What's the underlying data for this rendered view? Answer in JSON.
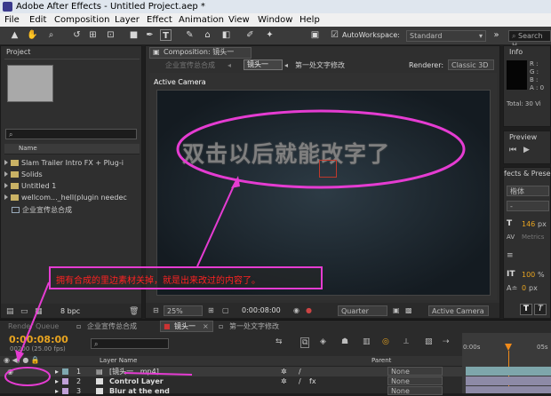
{
  "window": {
    "title": "Adobe After Effects - Untitled Project.aep *"
  },
  "menu": [
    "File",
    "Edit",
    "Composition",
    "Layer",
    "Effect",
    "Animation",
    "View",
    "Window",
    "Help"
  ],
  "toolbar": {
    "workspace_label": "AutoWorkspace:",
    "workspace_value": "Standard",
    "search_placeholder": "Search H"
  },
  "project": {
    "tab": "Project",
    "name_header": "Name",
    "items": [
      {
        "label": "Slam Trailer Intro FX + Plug-i",
        "type": "folder"
      },
      {
        "label": "Solids",
        "type": "folder"
      },
      {
        "label": "Untitled 1",
        "type": "folder"
      },
      {
        "label": "wellcom..._hell(plugin needec",
        "type": "folder"
      },
      {
        "label": "企业宣传总合成",
        "type": "comp"
      }
    ],
    "bpc": "8 bpc"
  },
  "composition": {
    "tab": "Composition: 镜头一",
    "breadcrumbs": [
      "企业宣传总合成",
      "镜头一",
      "第一处文字修改"
    ],
    "renderer_label": "Renderer:",
    "renderer_value": "Classic 3D",
    "active_camera": "Active Camera",
    "canvas_text": "双击以后就能改字了",
    "zoom": "25%",
    "timecode": "0:00:08:00",
    "resolution": "Quarter",
    "view": "Active Camera"
  },
  "annotation": {
    "text": "拥有合成的里边素材关掉，就是出来改过的内容了。"
  },
  "info": {
    "tab": "Info",
    "labels": [
      "R :",
      "G :",
      "B :",
      "A : 0"
    ],
    "total": "Total: 30  Vi"
  },
  "preview": {
    "tab": "Preview"
  },
  "effects": {
    "tab": "fects & Prese",
    "font_name": "楷体",
    "font_size": "146",
    "size_unit": "px",
    "metrics": "Metrics",
    "scale": "100",
    "scale_unit": "%",
    "baseline": "0",
    "baseline_unit": "px"
  },
  "timeline": {
    "tabs": [
      "Render Queue",
      "企业宣传总合成",
      "镜头一",
      "第一处文字修改"
    ],
    "timecode": "0:00:08:00",
    "fps": "00200 (25.00 fps)",
    "layer_name_header": "Layer Name",
    "parent_header": "Parent",
    "ruler": [
      "0:00s",
      "05s"
    ],
    "layers": [
      {
        "num": "1",
        "name": "[镜头一...mp4]",
        "parent": "None"
      },
      {
        "num": "2",
        "name": "Control Layer",
        "parent": "None"
      },
      {
        "num": "3",
        "name": "Blur at the end",
        "parent": "None"
      }
    ]
  },
  "colors": {
    "annotation": "#e53cd2",
    "annotation_text": "#ff2222",
    "timecode": "#e8a420",
    "playhead": "#f08a1a"
  }
}
